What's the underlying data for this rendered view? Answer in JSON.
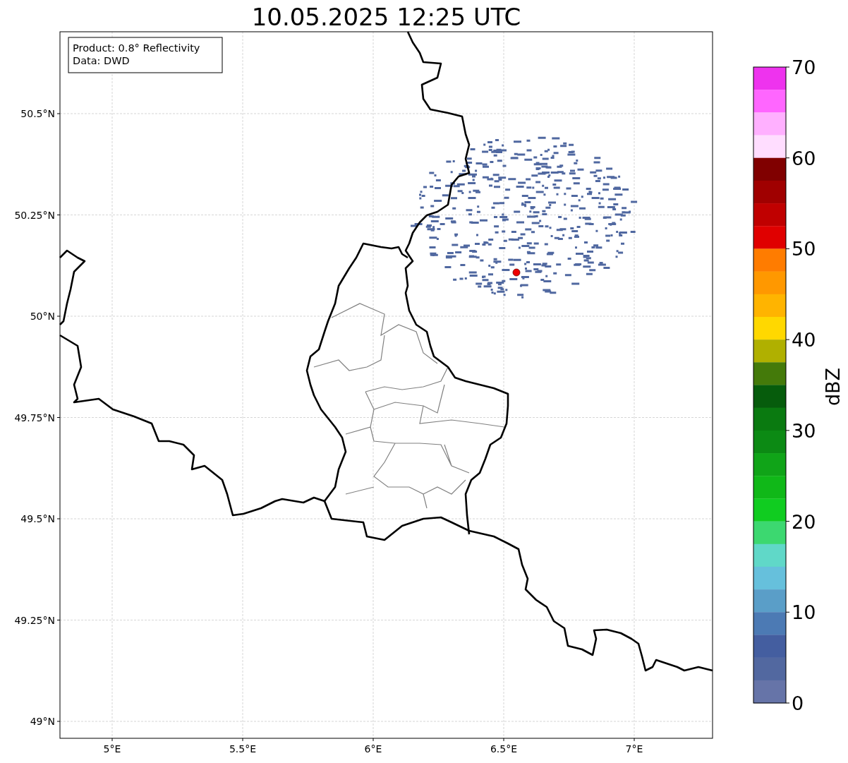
{
  "title": "10.05.2025 12:25 UTC",
  "legend": {
    "lines": [
      "Product: 0.8° Reflectivity",
      "Data: DWD"
    ]
  },
  "map": {
    "lon_labels": [
      "5°E",
      "5.5°E",
      "6°E",
      "6.5°E",
      "7°E"
    ],
    "lat_labels": [
      "50.5°N",
      "50.25°N",
      "50°N",
      "49.75°N",
      "49.5°N",
      "49.25°N",
      "49°N"
    ]
  },
  "colorbar": {
    "label": "dBZ",
    "tick_labels": [
      "70",
      "60",
      "50",
      "40",
      "30",
      "20",
      "10",
      "0"
    ],
    "segments": [
      {
        "color": "#ee33ee"
      },
      {
        "color": "#ff66ff"
      },
      {
        "color": "#ffb0ff"
      },
      {
        "color": "#ffddff"
      },
      {
        "color": "#800000"
      },
      {
        "color": "#a00000"
      },
      {
        "color": "#c00000"
      },
      {
        "color": "#e00000"
      },
      {
        "color": "#ff7c00"
      },
      {
        "color": "#ff9800"
      },
      {
        "color": "#ffb400"
      },
      {
        "color": "#ffd800"
      },
      {
        "color": "#b0b000"
      },
      {
        "color": "#447a0a"
      },
      {
        "color": "#065c0c"
      },
      {
        "color": "#0a7a10"
      },
      {
        "color": "#0c8a14"
      },
      {
        "color": "#10a418"
      },
      {
        "color": "#10b818"
      },
      {
        "color": "#10cc20"
      },
      {
        "color": "#3cd870"
      },
      {
        "color": "#60d8c8"
      },
      {
        "color": "#66c0dc"
      },
      {
        "color": "#5a9ec8"
      },
      {
        "color": "#4c7ab4"
      },
      {
        "color": "#445ea0"
      },
      {
        "color": "#5268a0"
      },
      {
        "color": "#6674a8"
      }
    ]
  }
}
